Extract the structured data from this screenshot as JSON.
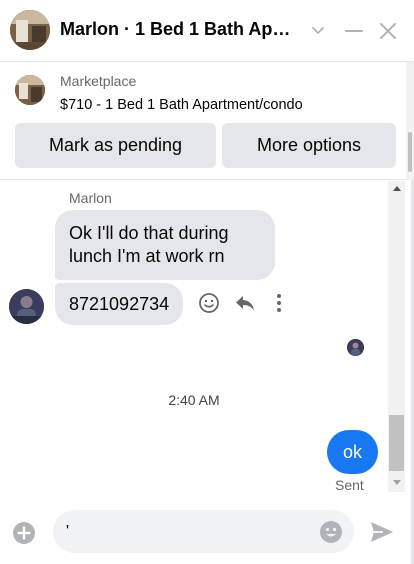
{
  "header": {
    "title": "Marlon · 1 Bed 1 Bath Apartment/condo",
    "icons": {
      "chevron": "chevron-down-icon",
      "minimize": "minimize-icon",
      "close": "close-icon"
    }
  },
  "marketplace": {
    "label": "Marketplace",
    "listing": "$710 - 1 Bed 1 Bath Apartment/condo",
    "buttons": {
      "pending": "Mark as pending",
      "options": "More options"
    }
  },
  "conversation": {
    "sender_name": "Marlon",
    "incoming": [
      "Ok I'll do that during\nlunch I'm at work rn",
      "8721092734"
    ],
    "timestamp": "2:40 AM",
    "outgoing": "ok",
    "status": "Sent",
    "actions": [
      "smile-icon",
      "reply-icon",
      "more-vertical-icon"
    ]
  },
  "composer": {
    "value": "'",
    "icons": [
      "plus-circle-icon",
      "emoji-icon",
      "send-icon"
    ]
  },
  "colors": {
    "accent": "#1877f2",
    "bubble_gray": "#e4e6eb",
    "icon_gray": "#65676b",
    "text": "#050505"
  }
}
